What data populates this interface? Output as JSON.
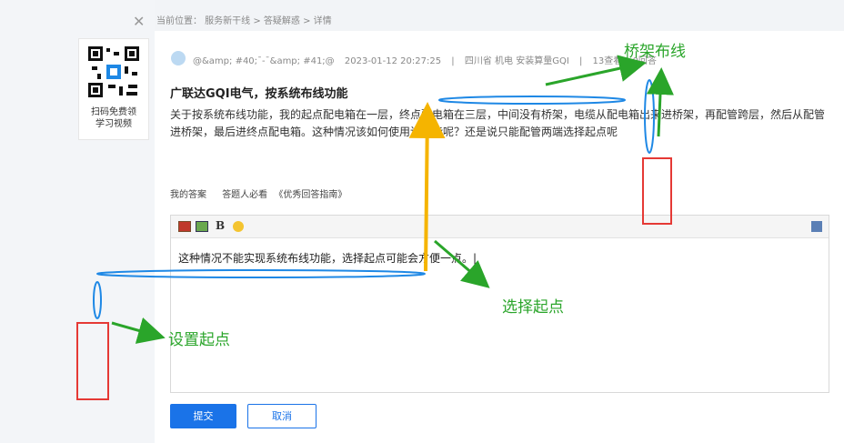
{
  "breadcrumb": "当前位置： 服务新干线 > 答疑解惑 > 详情",
  "qr": {
    "text_line1": "扫码免费领",
    "text_line2": "学习视频"
  },
  "question": {
    "user": "@&amp; #40;¯-¯&amp; #41;@",
    "time": "2023-01-12 20:27:25",
    "sep": "|",
    "location": "四川省  机电 安装算量GQI",
    "views": "13查看",
    "answers": "0回答",
    "title": "广联达GQI电气，按系统布线功能",
    "body": "关于按系统布线功能，我的起点配电箱在一层，终点配电箱在三层，中间没有桥架，电缆从配电箱出来进桥架，再配管跨层，然后从配管进桥架，最后进终点配电箱。这种情况该如何使用该功能呢？还是说只能配管两端选择起点呢"
  },
  "answer_tabs": {
    "my_answer": "我的答案",
    "must_read": "答题人必看",
    "guide": "《优秀回答指南》"
  },
  "editor": {
    "text": "这种情况不能实现系统布线功能，选择起点可能会方便一点。|",
    "bold": "B"
  },
  "buttons": {
    "submit": "提交",
    "cancel": "取消"
  },
  "annotations": {
    "tray": "桥架布线",
    "select_start": "选择起点",
    "set_start": "设置起点"
  },
  "colors": {
    "accent": "#1a73e8",
    "annotation_green": "#2aa52a",
    "arrow_yellow": "#f5b400",
    "box_red": "#e53935"
  }
}
